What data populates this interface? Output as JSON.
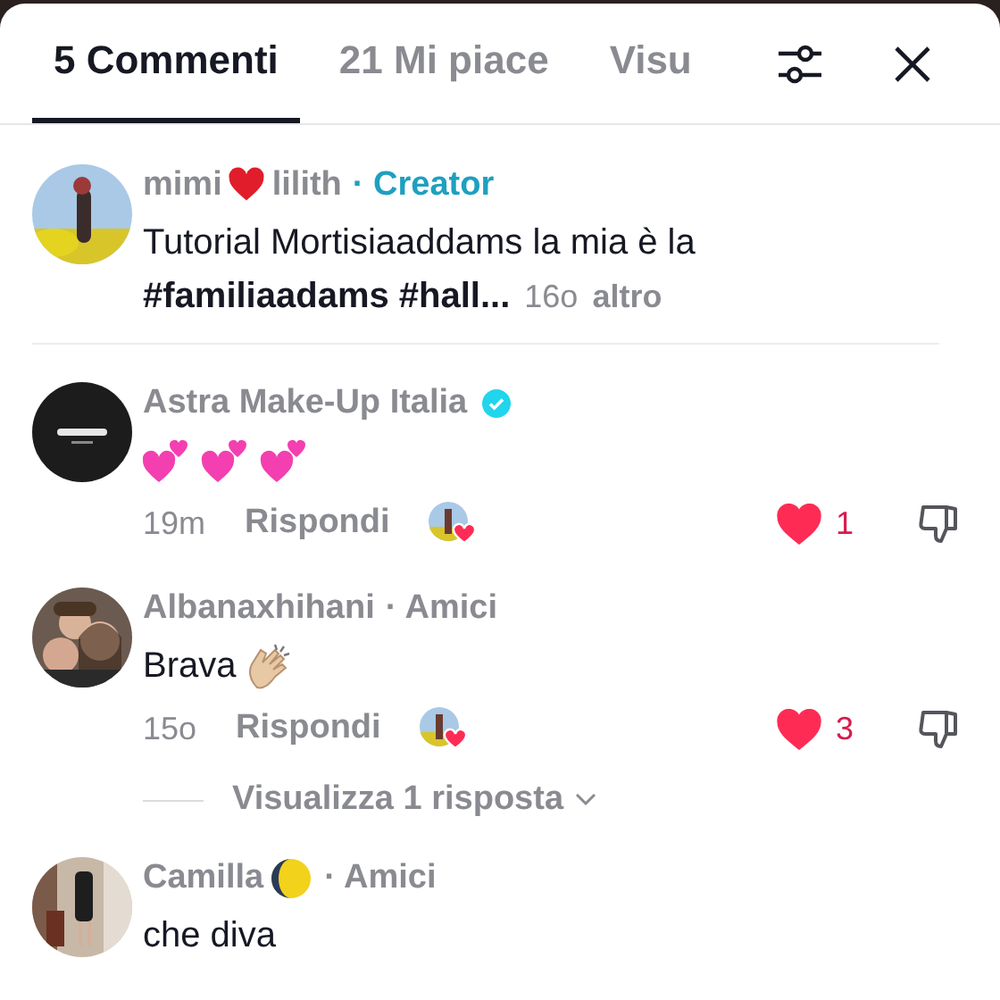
{
  "tabs": [
    {
      "label": "5 Commenti",
      "selected": true
    },
    {
      "label": "21 Mi piace",
      "selected": false
    },
    {
      "label": "Visu",
      "selected": false
    }
  ],
  "comments": [
    {
      "name": "mimi",
      "name_emoji": {
        "kind": "heart"
      },
      "name_after": "lilith",
      "role": {
        "text": "· Creator",
        "kind": "creator"
      },
      "body": "Tutorial Mortisiaaddams la mia è la",
      "tags": "#familiaadams #hall...",
      "time": "16o",
      "more": "altro"
    },
    {
      "name": "Astra Make-Up Italia",
      "verified": true,
      "body_emoji": {
        "kind": "hearts"
      },
      "time": "19m",
      "reply": "Rispondi",
      "creator_liked": true,
      "liked": true,
      "likes": "1"
    },
    {
      "name": "Albanaxhihani",
      "role": {
        "text": "· Amici",
        "kind": "friend"
      },
      "body": "Brava",
      "body_emoji": {
        "kind": "clap"
      },
      "time": "15o",
      "reply": "Rispondi",
      "creator_liked": true,
      "liked": true,
      "likes": "3",
      "replies": "Visualizza 1 risposta"
    },
    {
      "name": "Camilla",
      "name_emoji": {
        "kind": "moon"
      },
      "role": {
        "text": "· Amici",
        "kind": "friend"
      },
      "body": "che diva"
    }
  ]
}
